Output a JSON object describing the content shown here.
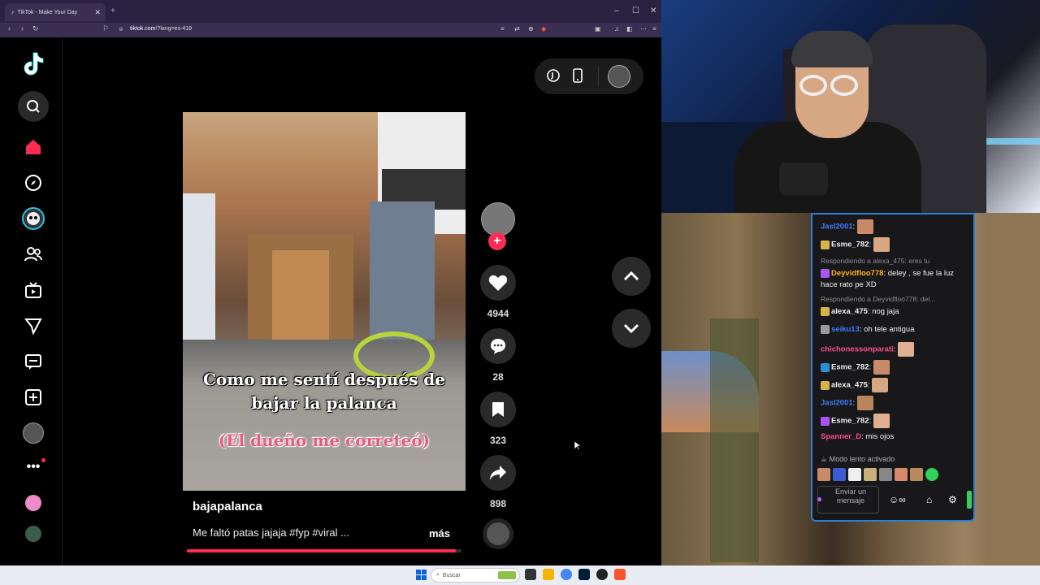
{
  "browser": {
    "tab_title": "TikTok - Make Your Day",
    "url_host": "tiktok.com",
    "url_path": "/?lang=es-419"
  },
  "tiktok": {
    "video": {
      "caption_line1": "Como me sentí después de",
      "caption_line2": "bajar la palanca",
      "caption_line3": "(El dueño me correteó)",
      "author": "bajapalanca",
      "description": "Me faltó patas jajaja #fyp #viral ...",
      "more_label": "más",
      "progress_fraction": 0.98
    },
    "actions": {
      "likes": "4944",
      "comments": "28",
      "saves": "323",
      "shares": "898"
    }
  },
  "taskbar": {
    "search_placeholder": "Buscar"
  },
  "chat": {
    "messages": [
      {
        "user": "Jasl2001",
        "color": "#3d7dff",
        "text": ""
      },
      {
        "user": "Esme_782",
        "color": "#efeff1",
        "text": ""
      },
      {
        "reply": "Respondiendo a alexa_475: eres tu"
      },
      {
        "user": "Deyvidfloo778",
        "color": "#ffb31a",
        "text": "deley , se fue la luz hace rato pe XD"
      },
      {
        "reply": "Respondiendo a Deyvidfloo778: del..."
      },
      {
        "user": "alexa_475",
        "color": "#efeff1",
        "text": "nog jaja"
      },
      {
        "user": "seiku13",
        "color": "#3d7dff",
        "text": "oh tele antigua"
      },
      {
        "user": "chichonessonparati",
        "color": "#ff4d8d",
        "text": ""
      },
      {
        "user": "Esme_782",
        "color": "#efeff1",
        "text": ""
      },
      {
        "user": "alexa_475",
        "color": "#efeff1",
        "text": ""
      },
      {
        "user": "Jasl2001",
        "color": "#3d7dff",
        "text": ""
      },
      {
        "user": "Esme_782",
        "color": "#efeff1",
        "text": ""
      },
      {
        "user": "Spanner_D",
        "color": "#ff4d8d",
        "text": "mis ojos"
      }
    ],
    "slow_mode": "Modo lento activado",
    "input_placeholder": "Enviar un mensaje"
  },
  "colors": {
    "tiktok_red": "#fe2c55",
    "chat_border": "#2a7fd6"
  }
}
